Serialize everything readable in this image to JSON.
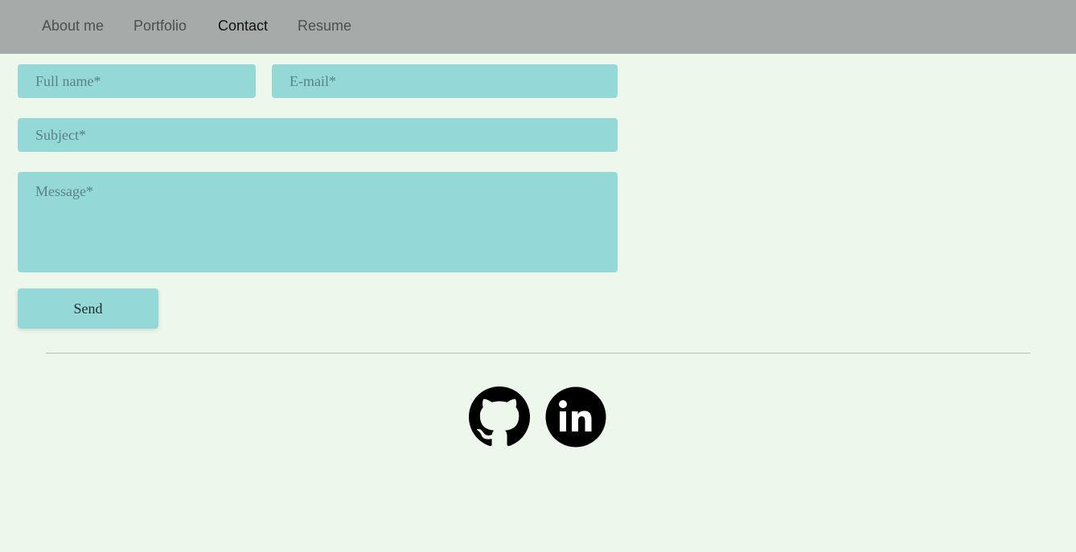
{
  "nav": {
    "items": [
      {
        "label": "About me",
        "active": false
      },
      {
        "label": "Portfolio",
        "active": false
      },
      {
        "label": "Contact",
        "active": true
      },
      {
        "label": "Resume",
        "active": false
      }
    ]
  },
  "form": {
    "full_name": {
      "value": "",
      "placeholder": "Full name*"
    },
    "email": {
      "value": "",
      "placeholder": "E-mail*"
    },
    "subject": {
      "value": "",
      "placeholder": "Subject*"
    },
    "message": {
      "value": "",
      "placeholder": "Message*"
    },
    "send_label": "Send"
  },
  "social": {
    "items": [
      {
        "icon": "github-icon"
      },
      {
        "icon": "linkedin-icon"
      }
    ]
  },
  "colors": {
    "page_background": "#edf7ec",
    "navbar": "#a6abaa",
    "field_background": "#94d8d8",
    "icon": "#000000"
  }
}
